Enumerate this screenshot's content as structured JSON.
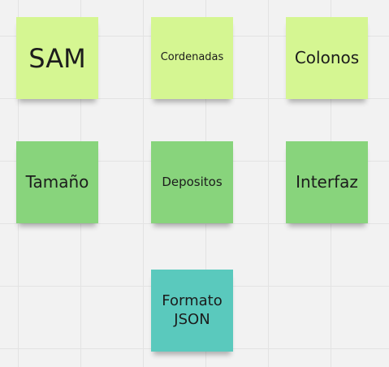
{
  "board": {
    "colors": {
      "lime": "#d5f692",
      "green": "#88d47c",
      "teal": "#5ac9bd"
    },
    "notes": [
      {
        "text": "SAM",
        "color": "lime"
      },
      {
        "text": "Cordenadas",
        "color": "lime"
      },
      {
        "text": "Colonos",
        "color": "lime"
      },
      {
        "text": "Tamaño",
        "color": "green"
      },
      {
        "text": "Depositos",
        "color": "green"
      },
      {
        "text": "Interfaz",
        "color": "green"
      },
      {
        "text": "Formato\nJSON",
        "color": "teal"
      }
    ]
  }
}
